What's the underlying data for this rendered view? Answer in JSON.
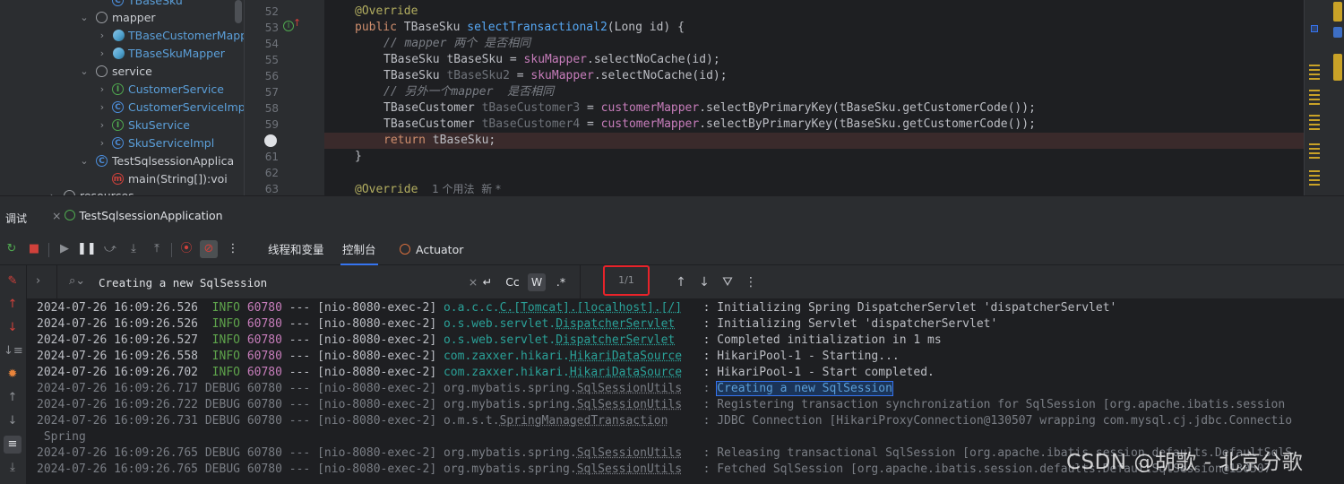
{
  "project_tree": {
    "items": [
      {
        "label": "TBaseSku",
        "kind": "class",
        "style": "blue"
      },
      {
        "label": "mapper",
        "kind": "folder",
        "style": "plain"
      },
      {
        "label": "TBaseCustomerMapper",
        "kind": "mapper",
        "style": "blue"
      },
      {
        "label": "TBaseSkuMapper",
        "kind": "mapper",
        "style": "blue"
      },
      {
        "label": "service",
        "kind": "folder",
        "style": "plain"
      },
      {
        "label": "CustomerService",
        "kind": "interface",
        "style": "blue"
      },
      {
        "label": "CustomerServiceImpl",
        "kind": "class",
        "style": "blue"
      },
      {
        "label": "SkuService",
        "kind": "interface",
        "style": "blue"
      },
      {
        "label": "SkuServiceImpl",
        "kind": "class",
        "style": "blue"
      },
      {
        "label": "TestSqlsessionApplica",
        "kind": "app",
        "style": "plain"
      },
      {
        "label": "main(String[]):voi",
        "kind": "method",
        "style": "plain"
      },
      {
        "label": "resources",
        "kind": "folder",
        "style": "plain"
      }
    ]
  },
  "editor": {
    "line_numbers": [
      "52",
      "53",
      "54",
      "55",
      "56",
      "57",
      "58",
      "59",
      "",
      "61",
      "62",
      "63"
    ],
    "lines": {
      "l52_annotation": "@Override",
      "l53_public": "public",
      "l53_type": "TBaseSku",
      "l53_method": "selectTransactional2",
      "l53_params": "(Long id) {",
      "l54_comment": "// mapper 两个 是否相同",
      "l55_a": "TBaseSku tBaseSku = ",
      "l55_field": "skuMapper",
      "l55_b": ".selectNoCache(id);",
      "l56_a": "TBaseSku ",
      "l56_var": "tBaseSku2",
      "l56_b": " = ",
      "l56_field": "skuMapper",
      "l56_c": ".selectNoCache(id);",
      "l57_comment": "// 另外一个mapper  是否相同",
      "l58_a": "TBaseCustomer ",
      "l58_var": "tBaseCustomer3",
      "l58_b": " = ",
      "l58_field": "customerMapper",
      "l58_c": ".selectByPrimaryKey(tBaseSku.getCustomerCode());",
      "l59_a": "TBaseCustomer ",
      "l59_var": "tBaseCustomer4",
      "l59_b": " = ",
      "l59_field": "customerMapper",
      "l59_c": ".selectByPrimaryKey(tBaseSku.getCustomerCode());",
      "l60_kw": "return",
      "l60_rest": " tBaseSku;",
      "l61": "}",
      "l63_annotation": "@Override",
      "l63_hint": "1 个用法  新 *"
    }
  },
  "debug": {
    "title": "调试",
    "run_tab": "TestSqlsessionApplication",
    "view_tabs": [
      "线程和变量",
      "控制台",
      "Actuator"
    ],
    "selected_view_tab": "控制台",
    "search": {
      "value": "Creating a new SqlSession",
      "options": [
        "Cc",
        "W",
        ".*"
      ],
      "match_count": "1/1"
    }
  },
  "console": {
    "lines": [
      {
        "ts": "2024-07-26 16:09:26.526",
        "level": "INFO",
        "pid": "60780",
        "thread": "[nio-8080-exec-2]",
        "logger_a": "o.a.c.c.",
        "logger_u": "C.[Tomcat].[localhost].[/]",
        "msg": ": Initializing Spring DispatcherServlet 'dispatcherServlet'"
      },
      {
        "ts": "2024-07-26 16:09:26.526",
        "level": "INFO",
        "pid": "60780",
        "thread": "[nio-8080-exec-2]",
        "logger_a": "o.s.web.servlet.",
        "logger_u": "DispatcherServlet",
        "msg": ": Initializing Servlet 'dispatcherServlet'"
      },
      {
        "ts": "2024-07-26 16:09:26.527",
        "level": "INFO",
        "pid": "60780",
        "thread": "[nio-8080-exec-2]",
        "logger_a": "o.s.web.servlet.",
        "logger_u": "DispatcherServlet",
        "msg": ": Completed initialization in 1 ms"
      },
      {
        "ts": "2024-07-26 16:09:26.558",
        "level": "INFO",
        "pid": "60780",
        "thread": "[nio-8080-exec-2]",
        "logger_a": "com.zaxxer.hikari.",
        "logger_u": "HikariDataSource",
        "msg": ": HikariPool-1 - Starting..."
      },
      {
        "ts": "2024-07-26 16:09:26.702",
        "level": "INFO",
        "pid": "60780",
        "thread": "[nio-8080-exec-2]",
        "logger_a": "com.zaxxer.hikari.",
        "logger_u": "HikariDataSource",
        "msg": ": HikariPool-1 - Start completed."
      },
      {
        "ts": "2024-07-26 16:09:26.717",
        "level": "DEBUG",
        "pid": "60780",
        "thread": "[nio-8080-exec-2]",
        "logger_a": "org.mybatis.spring.",
        "logger_u": "SqlSessionUtils",
        "msg": ": ",
        "match": "Creating a new SqlSession"
      },
      {
        "ts": "2024-07-26 16:09:26.722",
        "level": "DEBUG",
        "pid": "60780",
        "thread": "[nio-8080-exec-2]",
        "logger_a": "org.mybatis.spring.",
        "logger_u": "SqlSessionUtils",
        "msg": ": Registering transaction synchronization for SqlSession [org.apache.ibatis.session"
      },
      {
        "ts": "2024-07-26 16:09:26.731",
        "level": "DEBUG",
        "pid": "60780",
        "thread": "[nio-8080-exec-2]",
        "logger_a": "o.m.s.t.",
        "logger_u": "SpringManagedTransaction",
        "msg": ": JDBC Connection [HikariProxyConnection@130507 wrapping com.mysql.cj.jdbc.Connectio"
      },
      {
        "wrap": "Spring"
      },
      {
        "ts": "2024-07-26 16:09:26.765",
        "level": "DEBUG",
        "pid": "60780",
        "thread": "[nio-8080-exec-2]",
        "logger_a": "org.mybatis.spring.",
        "logger_u": "SqlSessionUtils",
        "msg": ": Releasing transactional SqlSession [org.apache.ibatis.session.defaults.DefaultSqlS"
      },
      {
        "ts": "2024-07-26 16:09:26.765",
        "level": "DEBUG",
        "pid": "60780",
        "thread": "[nio-8080-exec-2]",
        "logger_a": "org.mybatis.spring.",
        "logger_u": "SqlSessionUtils",
        "msg": ": Fetched SqlSession [org.apache.ibatis.session.defaults.DefaultSqlSession@130507"
      }
    ]
  },
  "watermark": "CSDN @胡歌 - 北京分歌",
  "colors": {
    "accent": "#3574f0",
    "info": "#5ea34b",
    "highlight_box": "#e8232a"
  }
}
